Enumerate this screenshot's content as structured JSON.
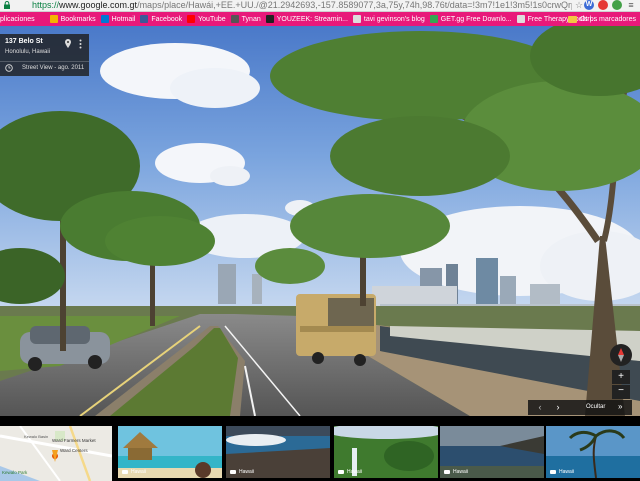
{
  "browser": {
    "url_https": "https://",
    "url_host": "www.google.com.gt",
    "url_rest": "/maps/place/Hawái,+EE.+UU./@21.2942693,-157.8589077,3a,75y,74h,98.76t/data=!3m7!1e1!3m5!1s0crwQrpodNbv",
    "colors": {
      "bookmark_bar": "#e8197a"
    }
  },
  "bookmarks": [
    {
      "label": "plicaciones",
      "icon": "apps-icon",
      "color": "#4285f4"
    },
    {
      "label": "Bookmarks",
      "icon": "star-icon",
      "color": "#f4b400"
    },
    {
      "label": "Hotmail",
      "icon": "hotmail-icon",
      "color": "#0078d4"
    },
    {
      "label": "Facebook",
      "icon": "facebook-icon",
      "color": "#3b5998"
    },
    {
      "label": "YouTube",
      "icon": "youtube-icon",
      "color": "#ff0000"
    },
    {
      "label": "Tynan",
      "icon": "tynan-icon",
      "color": "#555555"
    },
    {
      "label": "YOUZEEK: Streamin...",
      "icon": "youzeek-icon",
      "color": "#222222"
    },
    {
      "label": "tavi gevinson's blog",
      "icon": "blog-icon",
      "color": "#dddddd"
    },
    {
      "label": "GET.gg Free Downlo...",
      "icon": "getgg-icon",
      "color": "#34a853"
    },
    {
      "label": "Free Therapy Tools |...",
      "icon": "therapy-icon",
      "color": "#dddddd"
    }
  ],
  "bookmarks_other": "Otros marcadores",
  "streetview": {
    "address": "137 Belo St",
    "city": "Honolulu, Hawaii",
    "date": "Street View - ago. 2011"
  },
  "controls": {
    "zoom_in": "+",
    "zoom_out": "−",
    "prev": "‹",
    "next": "›",
    "hide": "Ocultar",
    "hide_chevron": "»"
  },
  "minimap": {
    "labels": [
      "Ward Farmers Market",
      "Ward Centers",
      "Kewalo Basin",
      "Kewalo Park"
    ]
  },
  "thumbnails": [
    {
      "label": "Hawaii"
    },
    {
      "label": "Hawaii"
    },
    {
      "label": "Hawaii"
    },
    {
      "label": "Hawaii"
    },
    {
      "label": "Hawaii"
    }
  ]
}
